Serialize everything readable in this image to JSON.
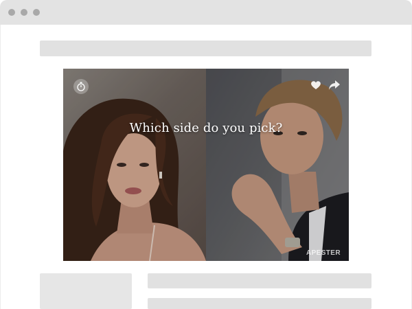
{
  "window": {
    "chrome_color": "#e3e3e3",
    "dot_color": "#a9a9a9"
  },
  "widget": {
    "question": "Which side do you pick?",
    "brand": "APESTER",
    "icons": {
      "timer": "stopwatch-icon",
      "like": "heart-icon",
      "share": "share-arrow-icon"
    },
    "options": [
      {
        "side": "left",
        "image": "woman-portrait"
      },
      {
        "side": "right",
        "image": "man-portrait"
      }
    ]
  }
}
